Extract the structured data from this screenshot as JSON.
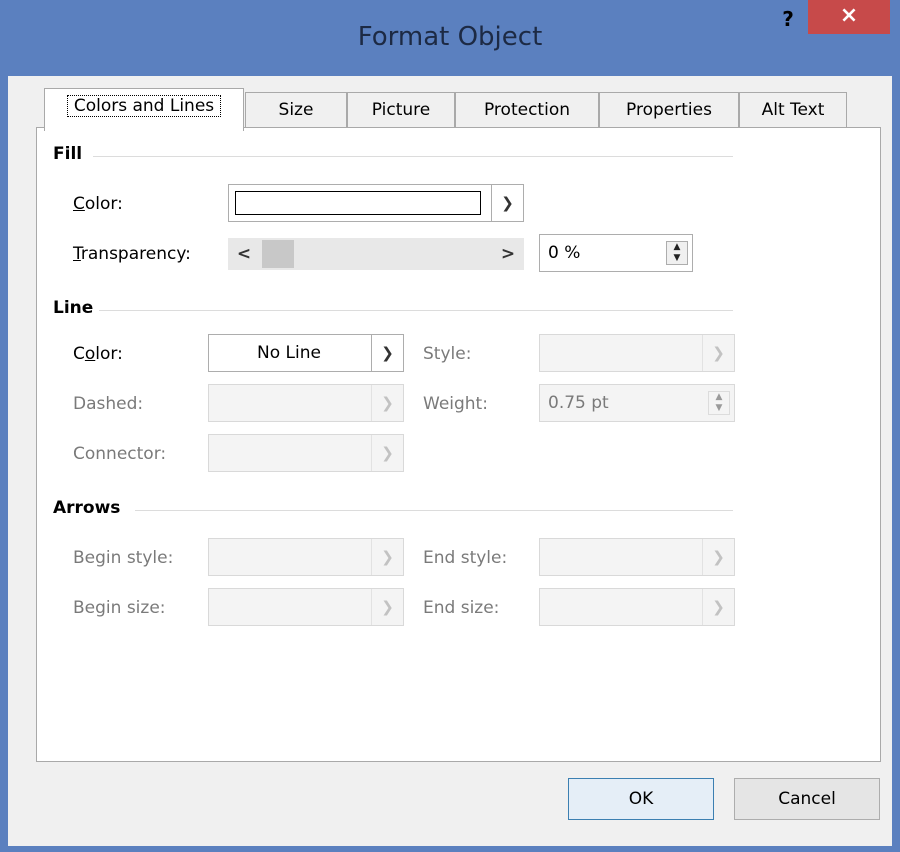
{
  "window": {
    "title": "Format Object",
    "help_label": "?",
    "close_label": "×"
  },
  "tabs": [
    {
      "label": "Colors and Lines",
      "active": true
    },
    {
      "label": "Size"
    },
    {
      "label": "Picture"
    },
    {
      "label": "Protection"
    },
    {
      "label": "Properties"
    },
    {
      "label": "Alt Text"
    }
  ],
  "fill": {
    "section_label": "Fill",
    "color_label_key": "C",
    "color_label_rest": "olor:",
    "color_value": "#ffffff",
    "transparency_label_key": "T",
    "transparency_label_rest": "ransparency:",
    "transparency_value": "0 %",
    "scroll_left": "<",
    "scroll_right": ">"
  },
  "line": {
    "section_label": "Line",
    "color_label_pre": "C",
    "color_label_key": "o",
    "color_label_rest": "lor:",
    "color_value": "No Line",
    "style_label": "Style:",
    "style_value": "",
    "dashed_label": "Dashed:",
    "dashed_value": "",
    "weight_label": "Weight:",
    "weight_value": "0.75 pt",
    "connector_label": "Connector:",
    "connector_value": ""
  },
  "arrows": {
    "section_label": "Arrows",
    "begin_style_label": "Begin style:",
    "end_style_label": "End style:",
    "begin_size_label": "Begin size:",
    "end_size_label": "End size:"
  },
  "buttons": {
    "ok_label": "OK",
    "cancel_label": "Cancel"
  },
  "icons": {
    "dropdown": "chevron-down-icon",
    "spin": "spin-up-down-icon"
  }
}
